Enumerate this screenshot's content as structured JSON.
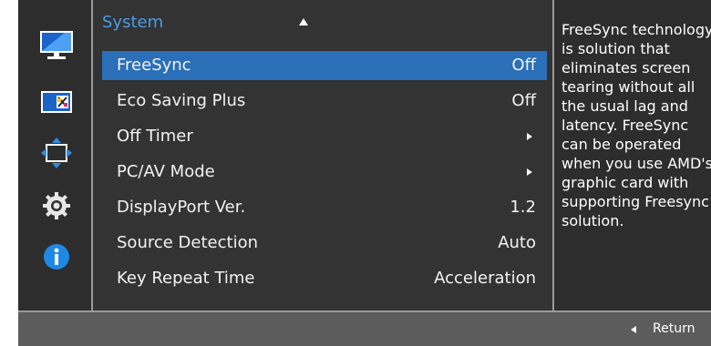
{
  "menu": {
    "title": "System",
    "items": [
      {
        "label": "FreeSync",
        "value": "Off",
        "selected": true
      },
      {
        "label": "Eco Saving Plus",
        "value": "Off"
      },
      {
        "label": "Off Timer",
        "value": ""
      },
      {
        "label": "PC/AV Mode",
        "value": ""
      },
      {
        "label": "DisplayPort Ver.",
        "value": "1.2"
      },
      {
        "label": "Source Detection",
        "value": "Auto"
      },
      {
        "label": "Key Repeat Time",
        "value": "Acceleration"
      }
    ]
  },
  "description": {
    "text": "FreeSync technology is solution that eliminates screen tearing without all the usual lag and latency. FreeSync can be operated when you use AMD's graphic card with supporting Freesync solution."
  },
  "footer": {
    "return_label": "Return"
  },
  "sidebar": {
    "icons": [
      "picture-icon",
      "onscreen-display-icon",
      "position-icon",
      "system-gear-icon",
      "information-icon"
    ]
  },
  "colors": {
    "accent": "#2a6fb8",
    "title": "#4a9be8",
    "info": "#1e88e5"
  }
}
